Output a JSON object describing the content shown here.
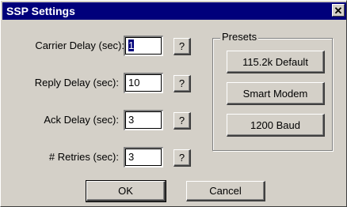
{
  "window": {
    "title": "SSP Settings",
    "close_glyph": "✕"
  },
  "fields": [
    {
      "label": "Carrier Delay (sec):",
      "value": "1",
      "help": "?"
    },
    {
      "label": "Reply Delay (sec):",
      "value": "10",
      "help": "?"
    },
    {
      "label": "Ack Delay (sec):",
      "value": "3",
      "help": "?"
    },
    {
      "label": "# Retries (sec):",
      "value": "3",
      "help": "?"
    }
  ],
  "presets": {
    "title": "Presets",
    "buttons": [
      "115.2k Default",
      "Smart Modem",
      "1200 Baud"
    ]
  },
  "footer": {
    "ok_label": "OK",
    "cancel_label": "Cancel"
  },
  "colors": {
    "titlebar": "#00007b",
    "dialog_face": "#d4d0c8",
    "selection": "#00007b"
  },
  "icons": {
    "close": "close-icon"
  }
}
